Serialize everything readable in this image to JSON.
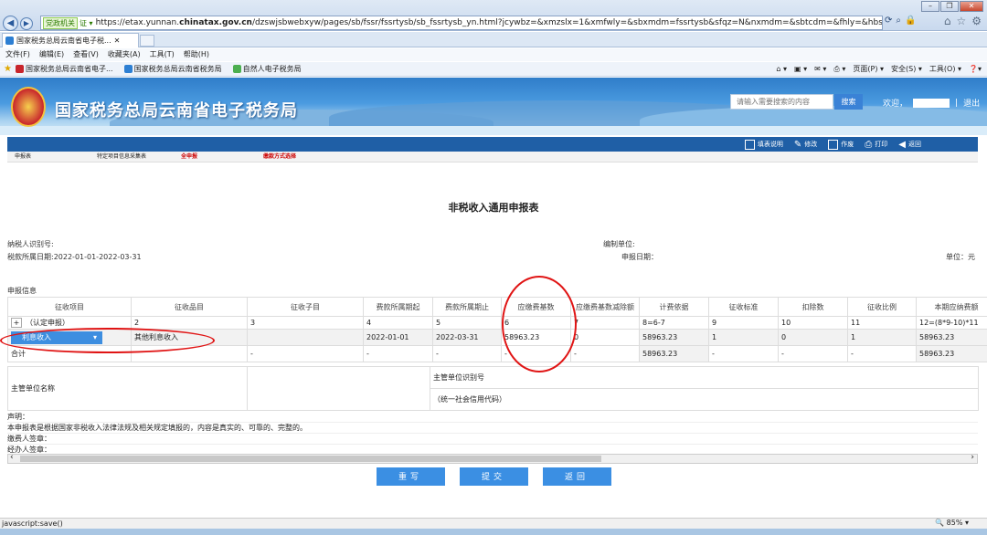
{
  "browser": {
    "gov_badge": "党政机关",
    "gov_badge_extra": "证 ▾",
    "url_prefix": "https://etax.yunnan.",
    "url_host": "chinatax.gov.cn",
    "url_rest": "/dzswjsbwebxyw/pages/sb/fssr/fssrtysb/sb_fssrtysb_yn.html?jcywbz=&xmzslx=1&xmfwly=&sbxmdm=fssrtysb&sfqz=N&nxmdm=&sbtcdm=&fhly=&hbsblx=&xsbt=&pzxh=12381",
    "tab_title": "国家税务总局云南省电子税...",
    "menu": [
      "文件(F)",
      "编辑(E)",
      "查看(V)",
      "收藏夹(A)",
      "工具(T)",
      "帮助(H)"
    ],
    "favorites": [
      "国家税务总局云南省电子...",
      "国家税务总局云南省税务局",
      "自然人电子税务局"
    ],
    "commands": [
      "页面(P) ▾",
      "安全(S) ▾",
      "工具(O) ▾"
    ],
    "status_text": "javascript:save()",
    "zoom": "85%"
  },
  "header": {
    "title": "国家税务总局云南省电子税务局",
    "search_placeholder": "请输入需要搜索的内容",
    "search_label": "搜索",
    "welcome": "欢迎，",
    "logout": "退出"
  },
  "toolbar": {
    "items": [
      "填表说明",
      "修改",
      "作废",
      "打印",
      "返回"
    ]
  },
  "steps": [
    "申报表",
    "特定项目信息采集表",
    "全申报",
    "缴款方式选择"
  ],
  "form": {
    "title": "非税收入通用申报表",
    "taxpayer_id_label": "纳税人识别号:",
    "period_label": "税款所属日期:2022-01-01-2022-03-31",
    "prepare_unit_label": "编制单位:",
    "filing_date_label": "申报日期：",
    "unit_label": "单位：元",
    "section_label": "申报信息",
    "headers": [
      "征收项目",
      "征收品目",
      "征收子目",
      "费款所属期起",
      "费款所属期止",
      "应缴费基数",
      "应缴费基数减除额",
      "计费依据",
      "征收标准",
      "扣除数",
      "征收比例",
      "本期应纳费额"
    ],
    "index_row": [
      "（认定申报）",
      "2",
      "3",
      "4",
      "5",
      "6",
      "7",
      "8=6-7",
      "9",
      "10",
      "11",
      "12=(8*9-10)*11"
    ],
    "data_row": {
      "project": "利息收入",
      "item": "其他利息收入",
      "sub": "",
      "start": "2022-01-01",
      "end": "2022-03-31",
      "base": "58963.23",
      "deduct": "0",
      "basis": "58963.23",
      "standard": "1",
      "deduction": "0",
      "ratio": "1",
      "amount": "58963.23"
    },
    "total_row": {
      "label": "合计",
      "dash": "-",
      "basis": "58963.23",
      "amount": "58963.23"
    },
    "authority_name_label": "主管单位名称",
    "authority_id_label": "主管单位识别号",
    "credit_code_label": "（统一社会信用代码）",
    "declaration_title": "声明：",
    "declaration_text": "本申报表是根据国家非税收入法律法规及相关规定填报的，内容是真实的、可靠的、完整的。",
    "payer_sign": "缴费人签章：",
    "agent_sign": "经办人签章："
  },
  "actions": [
    "重写",
    "提交",
    "返回"
  ]
}
